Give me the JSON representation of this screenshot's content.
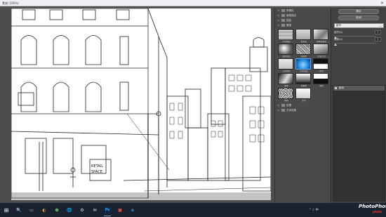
{
  "window": {
    "title": "素描 (100%)",
    "close_glyph": "×"
  },
  "canvas": {
    "zoom_controls": "－ ＋",
    "zoom": "100%",
    "image_desc": "photocopy-filtered street with buildings"
  },
  "filter_gallery": {
    "categories": [
      {
        "label": "风格化",
        "expanded": false
      },
      {
        "label": "画笔描边",
        "expanded": false
      },
      {
        "label": "扭曲",
        "expanded": false
      },
      {
        "label": "素描",
        "expanded": true
      }
    ],
    "thumbnails": [
      {
        "label": "半调图案"
      },
      {
        "label": "便条纸"
      },
      {
        "label": "粉笔和炭笔"
      },
      {
        "label": "铬黄渐变"
      },
      {
        "label": "绘图笔"
      },
      {
        "label": "基底凸现"
      },
      {
        "label": "石膏效果"
      },
      {
        "label": "水彩画纸"
      },
      {
        "label": "撕边"
      },
      {
        "label": "炭笔"
      },
      {
        "label": "炭精笔"
      },
      {
        "label": "图章"
      },
      {
        "label": "网状"
      },
      {
        "label": "影印"
      }
    ],
    "categories_after": [
      {
        "label": "纹理",
        "expanded": false
      },
      {
        "label": "艺术效果",
        "expanded": false
      }
    ]
  },
  "settings": {
    "ok_label": "确定",
    "cancel_label": "取消",
    "filter_select": "影印",
    "params": [
      {
        "label": "细节(D)",
        "value": "1",
        "fraction": 0.04
      },
      {
        "label": "暗度(A)",
        "value": "1",
        "fraction": 0.04
      }
    ],
    "effect_layer": "影印",
    "effect_buttons": "▣ 🗑"
  },
  "taskbar": {
    "start_glyph": "⊞",
    "apps": [
      "🔍",
      "▭",
      "◐",
      "⬢",
      "🌐",
      "⚙",
      "✉",
      "Ps",
      "■",
      "e"
    ],
    "tray": "⌃ ♪ 中",
    "time": "",
    "date": ""
  },
  "watermark": {
    "brand": "PhotoPhoto",
    "sub": "photo"
  },
  "colors": {
    "accent": "#5aa8ff",
    "panel": "#4a4a4a",
    "taskbar": "#1a2230"
  }
}
